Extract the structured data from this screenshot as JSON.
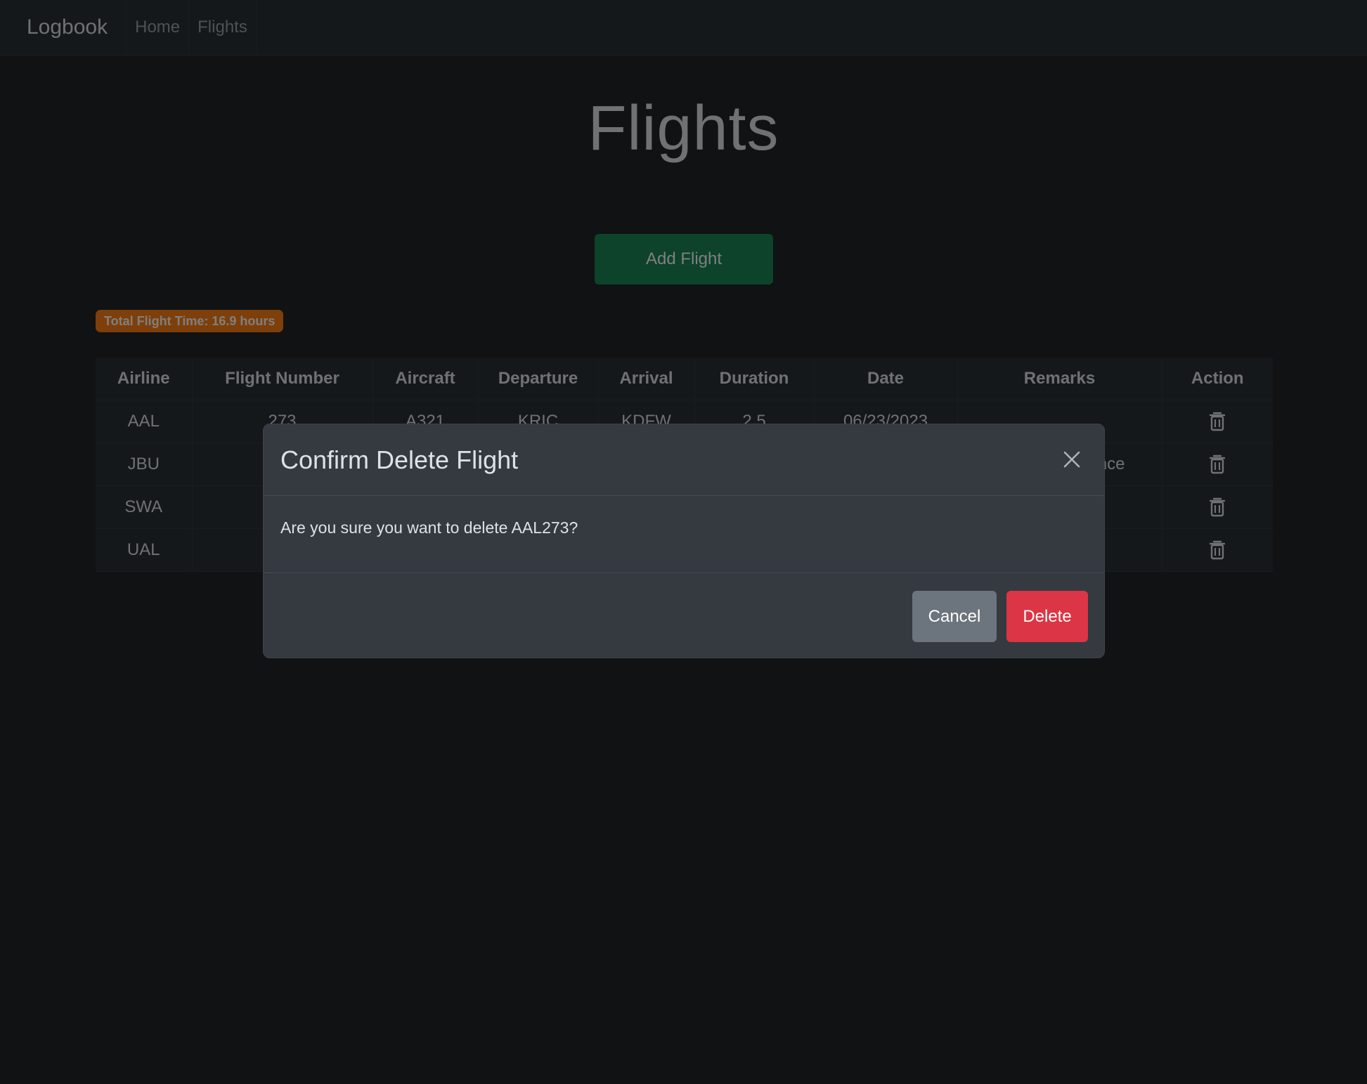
{
  "navbar": {
    "brand": "Logbook",
    "links": [
      "Home",
      "Flights"
    ]
  },
  "page": {
    "title": "Flights",
    "add_button": "Add Flight",
    "total_badge": "Total Flight Time: 16.9 hours"
  },
  "table": {
    "headers": [
      "Airline",
      "Flight Number",
      "Aircraft",
      "Departure",
      "Arrival",
      "Duration",
      "Date",
      "Remarks",
      "Action"
    ],
    "rows": [
      [
        "AAL",
        "273",
        "A321",
        "KRIC",
        "KDFW",
        "2.5",
        "06/23/2023",
        ""
      ],
      [
        "JBU",
        "",
        "",
        "",
        "",
        "",
        "",
        "ence"
      ],
      [
        "SWA",
        "",
        "",
        "",
        "",
        "",
        "",
        ""
      ],
      [
        "UAL",
        "",
        "",
        "",
        "",
        "",
        "",
        ""
      ]
    ]
  },
  "icons": {
    "delete": "trash-icon",
    "close": "close-icon"
  },
  "modal": {
    "title": "Confirm Delete Flight",
    "body": "Are you sure you want to delete AAL273?",
    "cancel_label": "Cancel",
    "delete_label": "Delete"
  },
  "colors": {
    "background": "#212529",
    "success": "#198754",
    "warning": "#fd7e14",
    "danger": "#dc3545",
    "secondary": "#6c757d"
  }
}
